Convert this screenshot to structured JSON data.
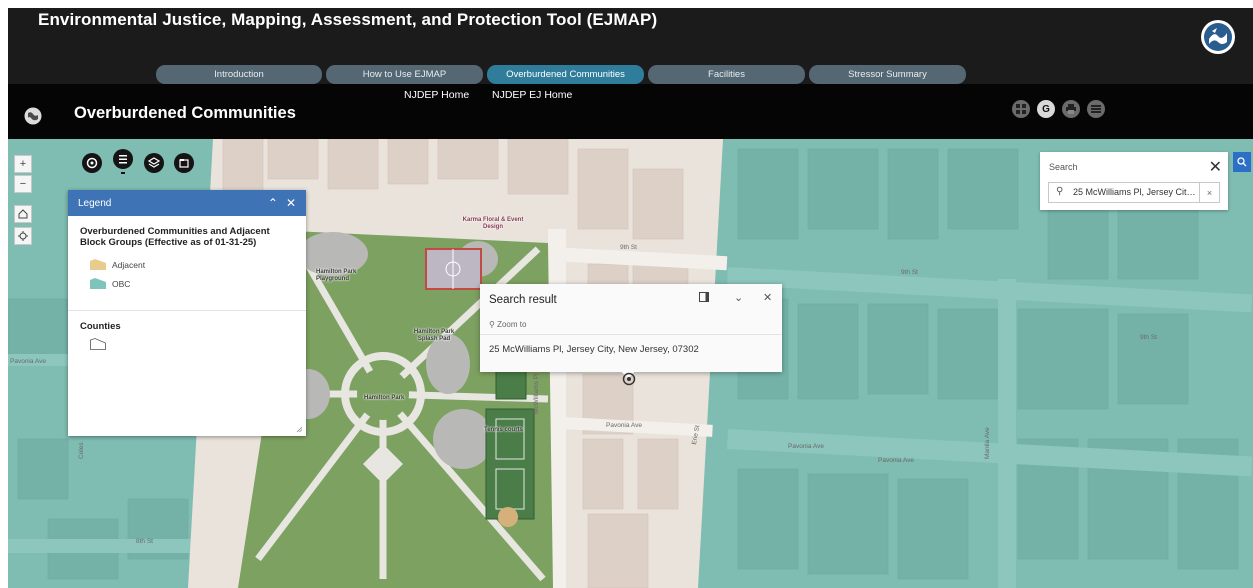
{
  "app": {
    "title": "Environmental Justice, Mapping, Assessment, and Protection Tool (EJMAP)"
  },
  "tabs": [
    {
      "label": "Introduction",
      "active": false
    },
    {
      "label": "How to Use EJMAP",
      "active": false
    },
    {
      "label": "Overburdened Communities",
      "active": true
    },
    {
      "label": "Facilities",
      "active": false
    },
    {
      "label": "Stressor Summary",
      "active": false
    }
  ],
  "subheader": {
    "page_title": "Overburdened Communities",
    "links": [
      "NJDEP Home",
      "NJDEP EJ Home"
    ],
    "icons": [
      "grid-icon",
      "google-icon",
      "print-icon",
      "share-icon"
    ]
  },
  "map_controls": {
    "zoom_in": "+",
    "zoom_out": "−",
    "icons": [
      "zoom-in-icon",
      "zoom-out-icon",
      "home-icon",
      "locate-icon"
    ]
  },
  "widgets": [
    "select-icon",
    "legend-list-icon",
    "layers-icon",
    "bookmark-icon"
  ],
  "legend": {
    "title": "Legend",
    "group1": "Overburdened Communities and Adjacent Block Groups (Effective as of 01-31-25)",
    "items": [
      {
        "label": "Adjacent",
        "color": "#e7cc8d"
      },
      {
        "label": "OBC",
        "color": "#7fc3bd"
      }
    ],
    "group2": "Counties"
  },
  "search": {
    "heading": "Search",
    "value": "25 McWilliams Pl, Jersey City, New Jersey, 07302",
    "clear": "×",
    "close": "✕",
    "accent": "#2b6fc7"
  },
  "popup": {
    "title": "Search result",
    "zoom_to": "Zoom to",
    "address": "25 McWilliams Pl, Jersey City, New Jersey, 07302"
  },
  "map_labels": {
    "ninth_st": "9th St",
    "eighth_st": "8th St",
    "pavonia_ave": "Pavonia Ave",
    "mcwilliams_pl": "McWilliams Pl",
    "erie_st": "Erie St",
    "manila_ave": "Manila Ave",
    "coles": "Coles",
    "karma": "Karma Floral & Event Design",
    "playground": "Hamilton Park Playground",
    "splash_pad": "Hamilton Park Splash Pad",
    "hamilton_park": "Hamilton Park",
    "tennis": "Tennis courts"
  },
  "colors": {
    "obc_fill": "#7fbcb1",
    "adjacent_fill": "#e9e3dc",
    "park_green": "#7da161",
    "header_bg": "#1b1b1b",
    "tab_active": "#2f7d9a",
    "legend_header": "#3e73b6"
  }
}
